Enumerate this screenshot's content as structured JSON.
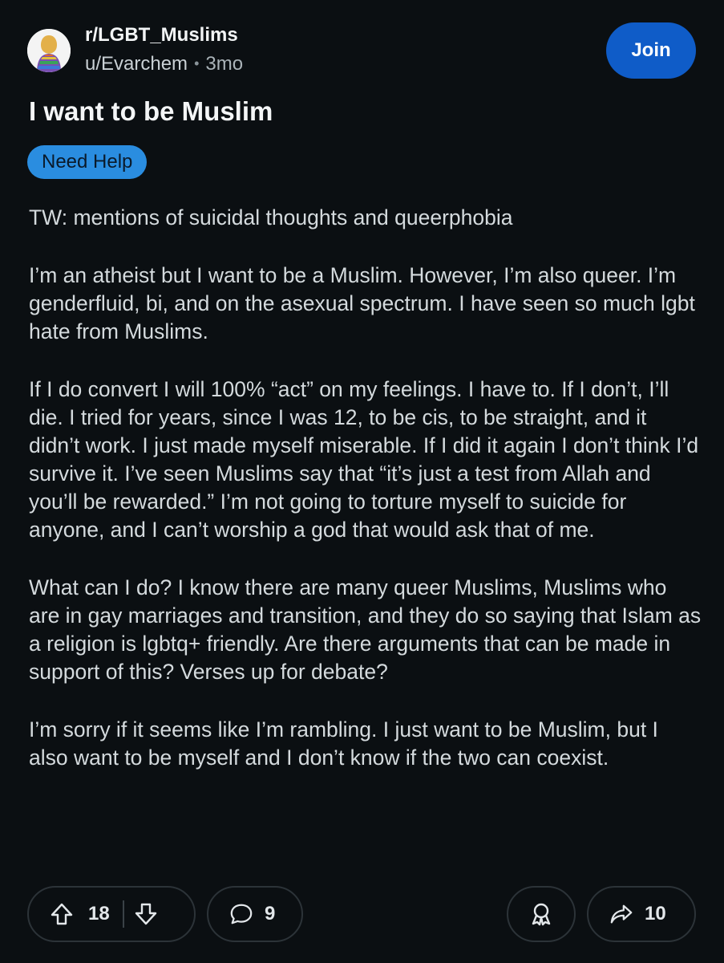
{
  "post": {
    "subreddit": "r/LGBT_Muslims",
    "author": "u/Evarchem",
    "separator": "•",
    "age": "3mo",
    "join_label": "Join",
    "title": "I want to be Muslim",
    "flair": "Need Help",
    "flair_color": "#2a8de0",
    "body": [
      "TW: mentions of suicidal thoughts and queerphobia",
      "I’m an atheist but I want to be a Muslim. However, I’m also queer. I’m genderfluid, bi, and on the asexual spectrum. I have seen so much lgbt hate from Muslims.",
      "If I do convert I will 100% “act” on my feelings. I have to. If I don’t, I’ll die. I tried for years, since I was 12, to be cis, to be straight, and it didn’t work. I just made myself miserable. If I did it again I don’t think I’d survive it. I’ve seen Muslims say that “it’s just a test from Allah and you’ll be rewarded.” I’m not going to torture myself to suicide for anyone, and I can’t worship a god that would ask that of me.",
      "What can I do? I know there are many queer Muslims, Muslims who are in gay marriages and transition, and they do so saying that Islam as a religion is lgbtq+ friendly. Are there arguments that can be made in support of this? Verses up for debate?",
      "I’m sorry if it seems like I’m rambling. I just want to be Muslim, but I also want to be myself and I don’t know if the two can coexist."
    ]
  },
  "actions": {
    "upvotes": "18",
    "comments": "9",
    "shares": "10",
    "icons": [
      "upvote-icon",
      "downvote-icon",
      "comment-icon",
      "award-icon",
      "share-icon"
    ]
  },
  "colors": {
    "background": "#0b0f12",
    "join_button": "#0f5cc8",
    "text": "#d4dadd"
  }
}
